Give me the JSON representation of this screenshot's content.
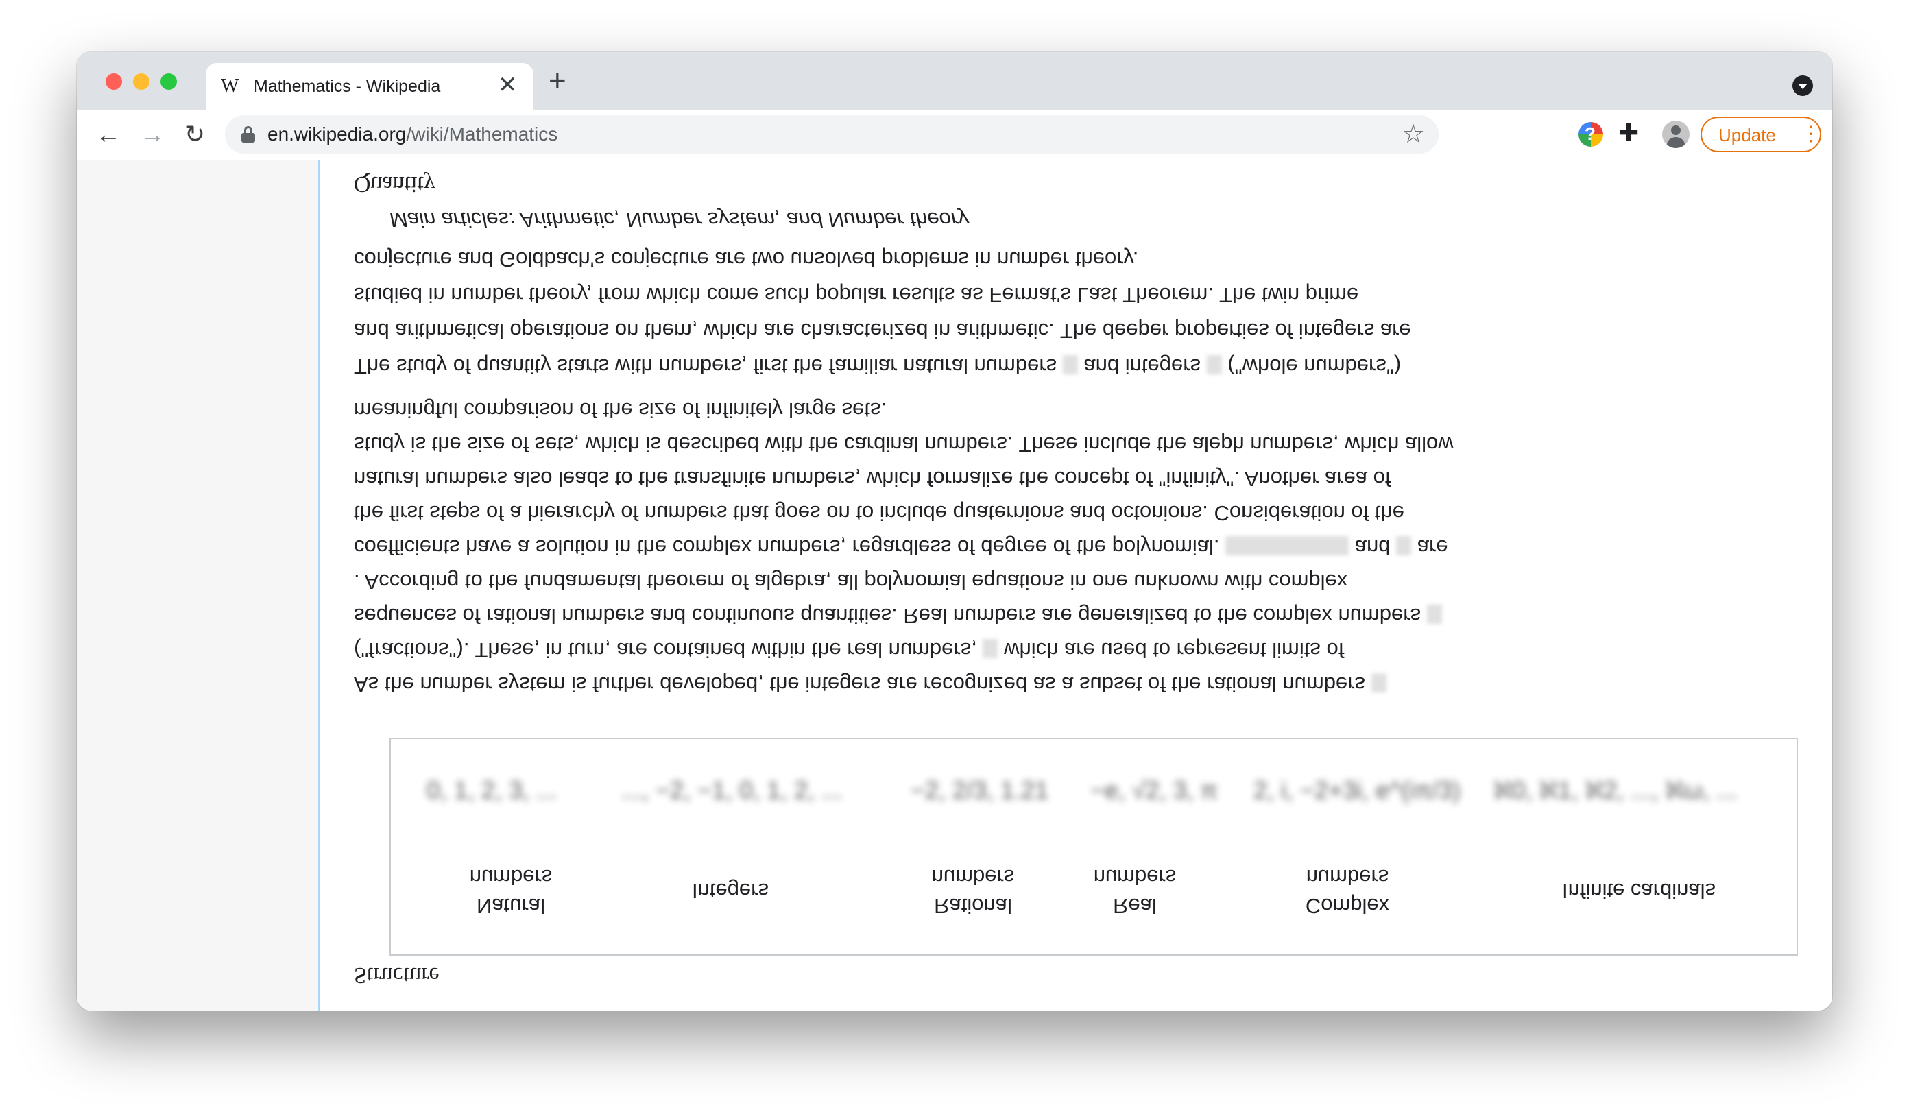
{
  "browser": {
    "tab": {
      "title": "Mathematics - Wikipedia",
      "favicon": "W",
      "close": "✕"
    },
    "new_tab": "+",
    "nav": {
      "back": "←",
      "forward": "→",
      "reload": "↻"
    },
    "omnibox": {
      "host": "en.wikipedia.org",
      "path": "/wiki/Mathematics"
    },
    "bookmark_star": "☆",
    "extensions_icon": "✚",
    "update": {
      "label": "Update",
      "menu": "⋮"
    }
  },
  "article": {
    "section_quantity": "Quantity",
    "hatnote": "Main articles: Arithmetic, Number system, and Number theory",
    "para1": [
      "The study of quantity starts with numbers, first the familiar natural numbers",
      "and integers",
      "(\"whole numbers\")",
      "and arithmetical operations on them, which are characterized in arithmetic. The deeper properties of integers are",
      "studied in number theory, from which come such popular results as Fermat's Last Theorem. The twin prime",
      "conjecture and Goldbach's conjecture are two unsolved problems in number theory."
    ],
    "para2": [
      "As the number system is further developed, the integers are recognized as a subset of the rational numbers",
      "(\"fractions\"). These, in turn, are contained within the real numbers,",
      "which are used to represent limits of",
      "sequences of rational numbers and continuous quantities. Real numbers are generalized to the complex numbers",
      ". According to the fundamental theorem of algebra, all polynomial equations in one unknown with complex",
      "coefficients have a solution in the complex numbers, regardless of degree of the polynomial.",
      "and",
      "are",
      "the first steps of a hierarchy of numbers that goes on to include quaternions and octonions. Consideration of the",
      "natural numbers also leads to the transfinite numbers, which formalize the concept of \"infinity\". Another area of",
      "study is the size of sets, which is described with the cardinal numbers. These include the aleph numbers, which allow",
      "meaningful comparison of the size of infinitely large sets."
    ],
    "figure": {
      "formulas": [
        "0, 1, 2, 3, ...",
        "..., −2, −1, 0, 1, 2, ...",
        "−2, 2/3, 1.21",
        "−e, √2, 3, π",
        "2, i, −2+3i, e^(iπ/3)",
        "ℵ0, ℵ1, ℵ2, ..., ℵω, ..."
      ],
      "labels": [
        {
          "line1": "Natural",
          "line2": "numbers"
        },
        {
          "line1": "Integers",
          "line2": ""
        },
        {
          "line1": "Rational",
          "line2": "numbers"
        },
        {
          "line1": "Real",
          "line2": "numbers"
        },
        {
          "line1": "Complex",
          "line2": "numbers"
        },
        {
          "line1": "Infinite cardinals",
          "line2": ""
        }
      ]
    },
    "section_structure": "Structure"
  }
}
